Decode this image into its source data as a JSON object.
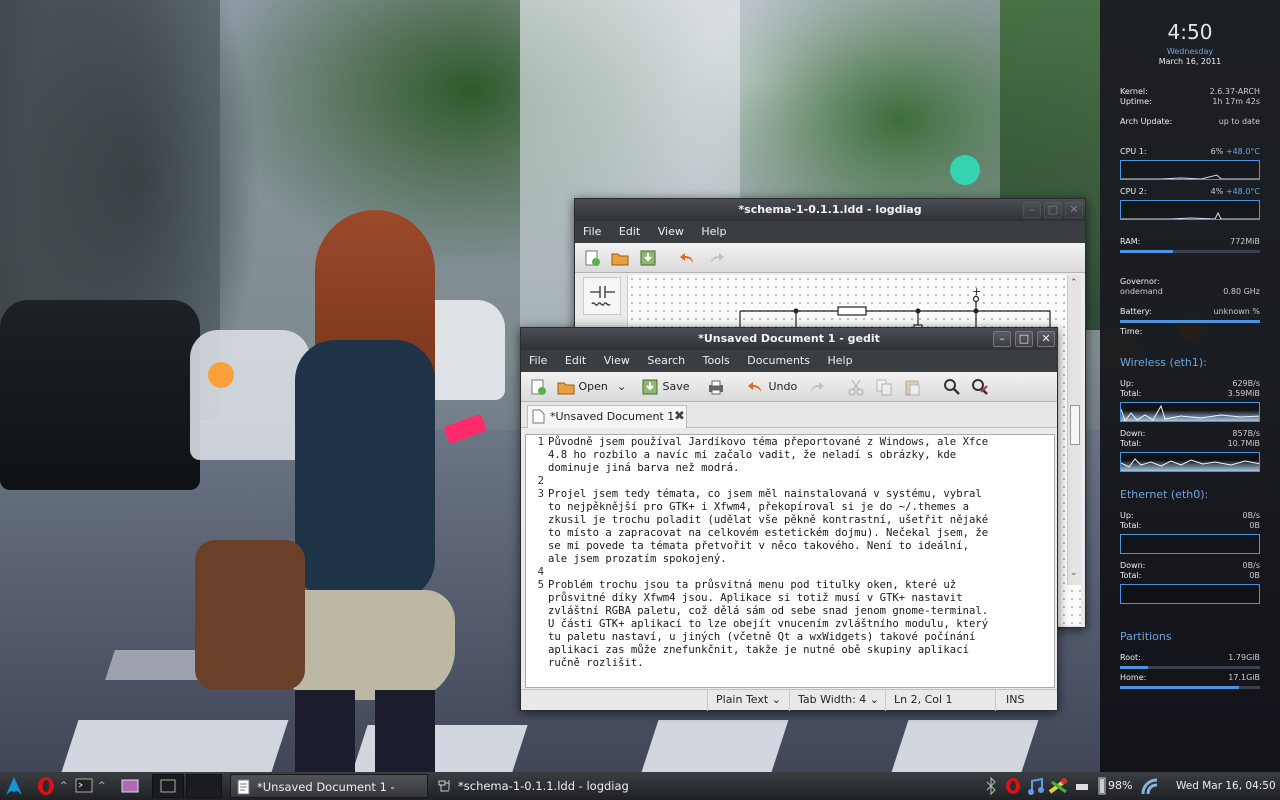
{
  "colors": {
    "accent": "#4d93e0",
    "panel_bg": "#2b2d31",
    "conky_bg": "#0c0e12"
  },
  "conky": {
    "time": "4:50",
    "weekday": "Wednesday",
    "date": "March 16, 2011",
    "kernel_label": "Kernel:",
    "kernel_value": "2.6.37-ARCH",
    "uptime_label": "Uptime:",
    "uptime_value": "1h 17m 42s",
    "arch_update_label": "Arch Update:",
    "arch_update_value": "up to date",
    "cpu1_label": "CPU 1:",
    "cpu1_value": "6%",
    "cpu1_temp": "+48.0°C",
    "cpu1_usage": 0.06,
    "cpu2_label": "CPU 2:",
    "cpu2_value": "4%",
    "cpu2_temp": "+48.0°C",
    "cpu2_usage": 0.04,
    "ram_label": "RAM:",
    "ram_value": "772MiB",
    "ram_usage": 0.38,
    "governor_label": "Governor:",
    "governor_value": "ondemand",
    "freq_value": "0.80 GHz",
    "battery_label": "Battery:",
    "battery_value": "unknown %",
    "battery_level": 1.0,
    "time_label": "Time:",
    "wireless_title": "Wireless (eth1):",
    "wl_up_label": "Up:",
    "wl_up_value": "629B/s",
    "wl_up_total_label": "Total:",
    "wl_up_total_value": "3.59MiB",
    "wl_down_label": "Down:",
    "wl_down_value": "857B/s",
    "wl_down_total_label": "Total:",
    "wl_down_total_value": "10.7MiB",
    "ethernet_title": "Ethernet (eth0):",
    "eth_up_label": "Up:",
    "eth_up_value": "0B/s",
    "eth_up_total_label": "Total:",
    "eth_up_total_value": "0B",
    "eth_down_label": "Down:",
    "eth_down_value": "0B/s",
    "eth_down_total_label": "Total:",
    "eth_down_total_value": "0B",
    "partitions_title": "Partitions",
    "root_label": "Root:",
    "root_value": "1.79GiB",
    "root_usage": 0.2,
    "home_label": "Home:",
    "home_value": "17.1GiB",
    "home_usage": 0.85
  },
  "logdiag": {
    "title": "*schema-1-0.1.1.ldd - logdiag",
    "menu": [
      "File",
      "Edit",
      "View",
      "Help"
    ],
    "node_label": "+"
  },
  "gedit": {
    "title": "*Unsaved Document 1 - gedit",
    "menu": [
      "File",
      "Edit",
      "View",
      "Search",
      "Tools",
      "Documents",
      "Help"
    ],
    "open_label": "Open",
    "save_label": "Save",
    "undo_label": "Undo",
    "tab_label": "*Unsaved Document 1",
    "lines": [
      {
        "num": "1",
        "text": "Původně jsem používal Jardíkovo téma přeportované z Windows, ale Xfce\n4.8 ho rozbilo a navíc mi začalo vadit, že neladí s obrázky, kde\ndominuje jiná barva než modrá."
      },
      {
        "num": "2",
        "text": ""
      },
      {
        "num": "3",
        "text": "Projel jsem tedy témata, co jsem měl nainstalovaná v systému, vybral\nto nejpěknější pro GTK+ i Xfwm4, překopíroval si je do ~/.themes a\nzkusil je trochu poladit (udělat vše pěkně kontrastní, ušetřit nějaké\nto místo a zapracovat na celkovém estetickém dojmu). Nečekal jsem, že\nse mi povede ta témata přetvořit v něco takového. Není to ideální,\nale jsem prozatím spokojený."
      },
      {
        "num": "4",
        "text": ""
      },
      {
        "num": "5",
        "text": "Problém trochu jsou ta průsvitná menu pod titulky oken, které už\nprůsvitné díky Xfwm4 jsou. Aplikace si totiž musí v GTK+ nastavit\nzvláštní RGBA paletu, což dělá sám od sebe snad jenom gnome-terminal.\nU části GTK+ aplikací to lze obejít vnucením zvláštního modulu, který\ntu paletu nastaví, u jiných (včetně Qt a wxWidgets) takové počínání\naplikaci zas může znefunkčnit, takže je nutné obě skupiny aplikací\nručně rozlišit."
      }
    ],
    "status": {
      "language": "Plain Text",
      "tab_width": "Tab Width:  4",
      "position": "Ln 2, Col 1",
      "mode": "INS"
    }
  },
  "panel": {
    "tasks": [
      "*Unsaved Document 1 - gedit",
      "*schema-1-0.1.1.ldd - logdiag"
    ],
    "battery": "98%",
    "clock": "Wed Mar 16, 04:50"
  }
}
